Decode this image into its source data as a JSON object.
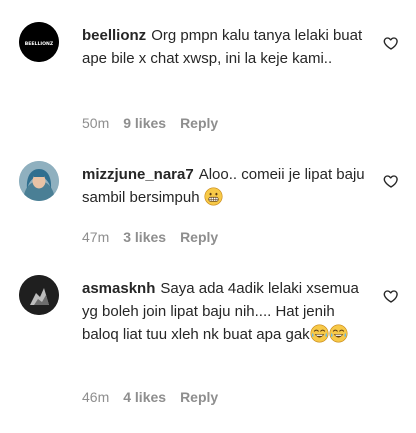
{
  "comments": [
    {
      "username": "beellionz",
      "text": "Org pmpn kalu tanya lelaki buat ape bile x chat xwsp, ini la keje kami..",
      "time": "50m",
      "likes": "9 likes",
      "reply": "Reply",
      "avatar_text": "BEELLIONZ",
      "emojis": []
    },
    {
      "username": "mizzjune_nara7",
      "text": "Aloo.. comeii je lipat baju sambil bersimpuh",
      "time": "47m",
      "likes": "3 likes",
      "reply": "Reply",
      "emojis": [
        "grimacing-face"
      ]
    },
    {
      "username": "asmasknh",
      "text": "Saya ada 4adik lelaki xsemua yg boleh join lipat baju nih.... Hat jenih baloq liat tuu xleh nk buat apa gak",
      "time": "46m",
      "likes": "4 likes",
      "reply": "Reply",
      "emojis": [
        "tears-of-joy-face",
        "tears-of-joy-face"
      ]
    }
  ],
  "colors": {
    "text": "#262626",
    "secondary": "#8e8e8e",
    "avatar1_bg": "#000000",
    "avatar2_bg": "#7fa3b3",
    "avatar3_bg": "#2a2a2a"
  },
  "icons": {
    "like": "heart-outline-icon"
  }
}
